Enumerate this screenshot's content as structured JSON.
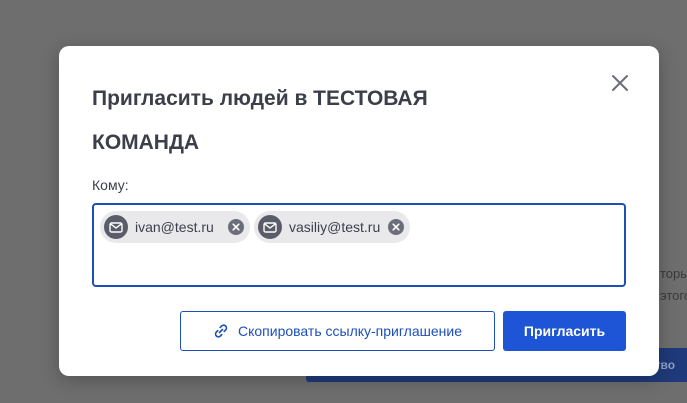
{
  "background": {
    "line_1": "торы",
    "line_2": "этого",
    "bar_text": "ство"
  },
  "dialog": {
    "title": "Пригласить людей в ТЕСТОВАЯ КОМАНДА",
    "close_icon": "close-icon",
    "to_label": "Кому:",
    "recipients": [
      {
        "email": "ivan@test.ru",
        "icon": "mail-icon"
      },
      {
        "email": "vasiliy@test.ru",
        "icon": "mail-icon"
      }
    ],
    "copy_link_label": "Скопировать ссылку-приглашение",
    "copy_link_icon": "link-icon",
    "invite_label": "Пригласить"
  },
  "colors": {
    "accent": "#1e55d6",
    "overlay": "#6e6e6e",
    "chip_background": "#e9e9ec"
  }
}
